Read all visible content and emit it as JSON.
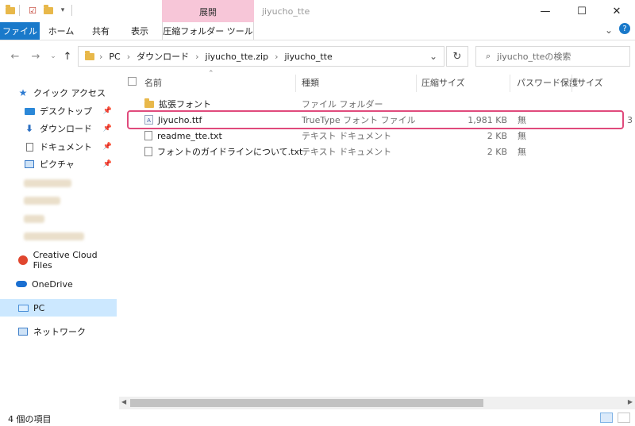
{
  "window": {
    "title": "jiyucho_tte",
    "context_header": "展開",
    "minimize": "—",
    "maximize": "☐",
    "close": "✕"
  },
  "ribbon": {
    "tabs": [
      "ファイル",
      "ホーム",
      "共有",
      "表示",
      "圧縮フォルダー ツール"
    ],
    "collapse": "⌄",
    "help": "?"
  },
  "address": {
    "path": [
      "PC",
      "ダウンロード",
      "jiyucho_tte.zip",
      "jiyucho_tte"
    ],
    "search_placeholder": "jiyucho_tteの検索"
  },
  "sidebar": {
    "items": [
      {
        "label": "クイック アクセス",
        "icon": "star-icon",
        "pinned": false
      },
      {
        "label": "デスクトップ",
        "icon": "desktop-icon",
        "pinned": true
      },
      {
        "label": "ダウンロード",
        "icon": "download-icon",
        "pinned": true
      },
      {
        "label": "ドキュメント",
        "icon": "document-icon",
        "pinned": true
      },
      {
        "label": "ピクチャ",
        "icon": "picture-icon",
        "pinned": true
      },
      {
        "label": "Creative Cloud Files",
        "icon": "creative-cloud-icon"
      },
      {
        "label": "OneDrive",
        "icon": "cloud-icon"
      },
      {
        "label": "PC",
        "icon": "pc-icon",
        "selected": true
      },
      {
        "label": "ネットワーク",
        "icon": "network-icon"
      }
    ]
  },
  "columns": [
    "名前",
    "種類",
    "圧縮サイズ",
    "パスワード保護",
    "サイズ"
  ],
  "files": [
    {
      "name": "拡張フォント",
      "type": "ファイル フォルダー",
      "size": "",
      "password": "",
      "icon": "folder-icon"
    },
    {
      "name": "Jiyucho.ttf",
      "type": "TrueType フォント ファイル",
      "size": "1,981 KB",
      "password": "無",
      "icon": "font-file-icon",
      "extra": "3"
    },
    {
      "name": "readme_tte.txt",
      "type": "テキスト ドキュメント",
      "size": "2 KB",
      "password": "無",
      "icon": "text-file-icon"
    },
    {
      "name": "フォントのガイドラインについて.txt",
      "type": "テキスト ドキュメント",
      "size": "2 KB",
      "password": "無",
      "icon": "text-file-icon"
    }
  ],
  "status": {
    "item_count": "4 個の項目"
  },
  "colors": {
    "file_tab": "#1979ca",
    "context_tab": "#f7c6d8",
    "highlight": "#e04a7c",
    "selected_nav": "#cce8ff"
  }
}
